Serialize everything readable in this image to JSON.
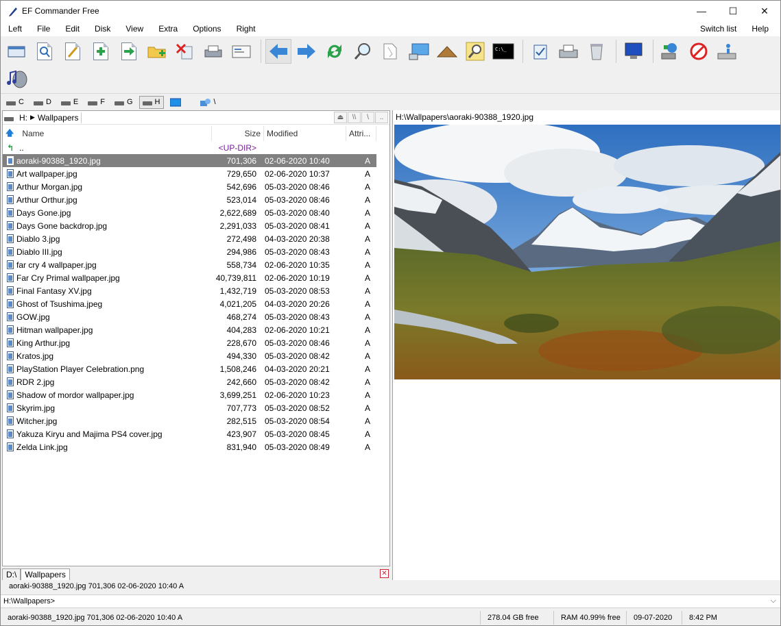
{
  "window": {
    "title": "EF Commander Free",
    "controls": [
      "—",
      "☐",
      "✕"
    ]
  },
  "menu": {
    "left_items": [
      "Left",
      "File",
      "Edit",
      "Disk",
      "View",
      "Extra",
      "Options",
      "Right"
    ],
    "right_items": [
      "Switch list",
      "Help"
    ]
  },
  "toolbar": {
    "row1": [
      "open-window-icon",
      "view-file-icon",
      "edit-file-icon",
      "copy-files-icon",
      "move-files-icon",
      "new-folder-icon",
      "delete-icon",
      "print-icon",
      "email-icon",
      "back-arrow-icon",
      "forward-arrow-icon",
      "refresh-icon",
      "search-icon",
      "file-compare-icon",
      "remote-desktop-icon",
      "pack-archive-icon",
      "find-files-icon",
      "command-prompt-icon",
      "checksum-icon",
      "fax-icon",
      "recycle-bin-icon",
      "monitor-icon",
      "network-drive-icon",
      "disconnect-drive-icon",
      "drive-info-icon"
    ],
    "row2": [
      "audio-player-icon"
    ]
  },
  "drives": [
    {
      "label": "C",
      "active": false
    },
    {
      "label": "D",
      "active": false
    },
    {
      "label": "E",
      "active": false
    },
    {
      "label": "F",
      "active": false
    },
    {
      "label": "G",
      "active": false
    },
    {
      "label": "H",
      "active": true
    }
  ],
  "drive_extra": {
    "root": "\\"
  },
  "left_panel": {
    "drive": "H:",
    "folder": "Wallpapers",
    "path_buttons": [
      "⏏",
      "\\\\",
      "\\",
      ".."
    ],
    "columns": {
      "name": "Name",
      "size": "Size",
      "modified": "Modified",
      "attr": "Attri..."
    },
    "updir": {
      "name": "..",
      "label": "<UP-DIR>"
    },
    "files": [
      {
        "name": "aoraki-90388_1920.jpg",
        "size": "701,306",
        "modified": "02-06-2020  10:40",
        "attr": "A",
        "selected": true
      },
      {
        "name": "Art wallpaper.jpg",
        "size": "729,650",
        "modified": "02-06-2020  10:37",
        "attr": "A"
      },
      {
        "name": "Arthur Morgan.jpg",
        "size": "542,696",
        "modified": "05-03-2020  08:46",
        "attr": "A"
      },
      {
        "name": "Arthur Orthur.jpg",
        "size": "523,014",
        "modified": "05-03-2020  08:46",
        "attr": "A"
      },
      {
        "name": "Days Gone.jpg",
        "size": "2,622,689",
        "modified": "05-03-2020  08:40",
        "attr": "A"
      },
      {
        "name": "Days Gone backdrop.jpg",
        "size": "2,291,033",
        "modified": "05-03-2020  08:41",
        "attr": "A"
      },
      {
        "name": "Diablo 3.jpg",
        "size": "272,498",
        "modified": "04-03-2020  20:38",
        "attr": "A"
      },
      {
        "name": "Diablo III.jpg",
        "size": "294,986",
        "modified": "05-03-2020  08:43",
        "attr": "A"
      },
      {
        "name": "far cry 4 wallpaper.jpg",
        "size": "558,734",
        "modified": "02-06-2020  10:35",
        "attr": "A"
      },
      {
        "name": "Far Cry Primal wallpaper.jpg",
        "size": "40,739,811",
        "modified": "02-06-2020  10:19",
        "attr": "A"
      },
      {
        "name": "Final Fantasy XV.jpg",
        "size": "1,432,719",
        "modified": "05-03-2020  08:53",
        "attr": "A"
      },
      {
        "name": "Ghost of Tsushima.jpeg",
        "size": "4,021,205",
        "modified": "04-03-2020  20:26",
        "attr": "A"
      },
      {
        "name": "GOW.jpg",
        "size": "468,274",
        "modified": "05-03-2020  08:43",
        "attr": "A"
      },
      {
        "name": "Hitman wallpaper.jpg",
        "size": "404,283",
        "modified": "02-06-2020  10:21",
        "attr": "A"
      },
      {
        "name": "King Arthur.jpg",
        "size": "228,670",
        "modified": "05-03-2020  08:46",
        "attr": "A"
      },
      {
        "name": "Kratos.jpg",
        "size": "494,330",
        "modified": "05-03-2020  08:42",
        "attr": "A"
      },
      {
        "name": "PlayStation Player Celebration.png",
        "size": "1,508,246",
        "modified": "04-03-2020  20:21",
        "attr": "A"
      },
      {
        "name": "RDR 2.jpg",
        "size": "242,660",
        "modified": "05-03-2020  08:42",
        "attr": "A"
      },
      {
        "name": "Shadow of mordor wallpaper.jpg",
        "size": "3,699,251",
        "modified": "02-06-2020  10:23",
        "attr": "A"
      },
      {
        "name": "Skyrim.jpg",
        "size": "707,773",
        "modified": "05-03-2020  08:52",
        "attr": "A"
      },
      {
        "name": "Witcher.jpg",
        "size": "282,515",
        "modified": "05-03-2020  08:54",
        "attr": "A"
      },
      {
        "name": "Yakuza Kiryu and Majima PS4 cover.jpg",
        "size": "423,907",
        "modified": "05-03-2020  08:45",
        "attr": "A"
      },
      {
        "name": "Zelda Link.jpg",
        "size": "831,940",
        "modified": "05-03-2020  08:49",
        "attr": "A"
      }
    ],
    "tabs": [
      "D:\\",
      "Wallpapers"
    ],
    "info": "aoraki-90388_1920.jpg    701,306  02-06-2020  10:40  A"
  },
  "right_panel": {
    "path": "H:\\Wallpapers\\aoraki-90388_1920.jpg"
  },
  "command_line": {
    "prompt": "H:\\Wallpapers>"
  },
  "status": {
    "file": "aoraki-90388_1920.jpg    701,306  02-06-2020  10:40  A",
    "free": "278.04 GB free",
    "ram": "RAM 40.99% free",
    "date": "09-07-2020",
    "time": "8:42 PM"
  },
  "colors": {
    "selection": "#808080",
    "updir": "#7a1aa0",
    "accent_blue": "#2a78d0"
  }
}
